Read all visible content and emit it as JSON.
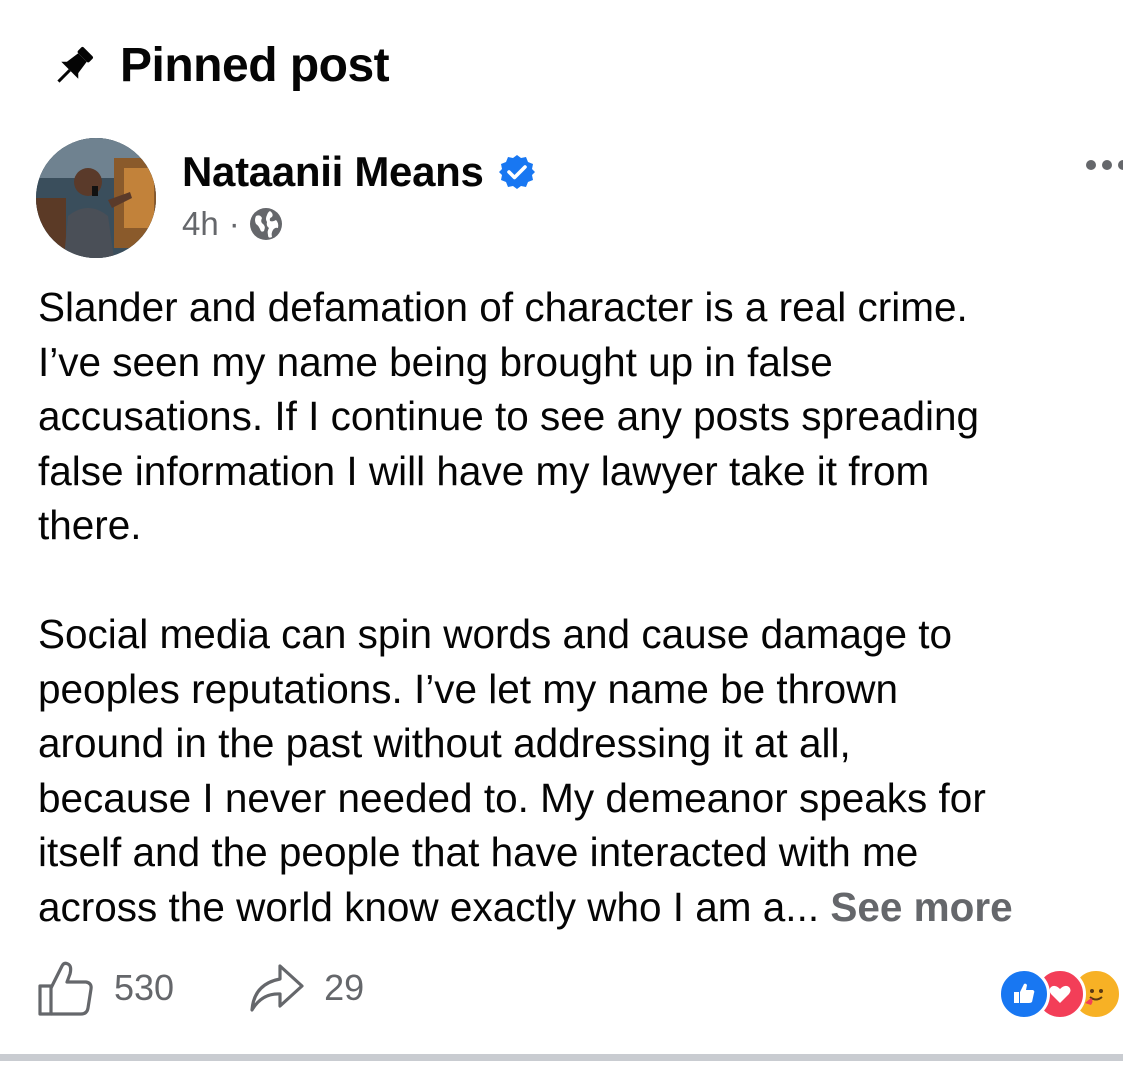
{
  "pinned": {
    "label": "Pinned post",
    "icon": "pin-icon"
  },
  "post": {
    "author": {
      "name": "Nataanii Means",
      "verified": true,
      "verified_icon": "verified-badge-icon",
      "avatar": "profile-photo"
    },
    "timestamp": "4h",
    "separator": "·",
    "audience_icon": "globe-icon",
    "more_icon": "more-options-icon",
    "body": {
      "paragraph1": [
        "Slander and defamation of character is a real crime.",
        "I’ve seen my name being brought up in false",
        "accusations. If I continue to see any posts spreading",
        "false information I will have my lawyer take it from",
        "there."
      ],
      "paragraph2": [
        "Social media can spin words and cause damage to",
        "peoples reputations. I’ve let my name be thrown",
        "around in the past without addressing it at all,",
        "because I never needed to. My demeanor speaks for",
        "itself and the people that have interacted with me",
        "across the world know exactly who I am a..."
      ],
      "see_more": " See more"
    },
    "stats": {
      "likes": "530",
      "shares": "29",
      "like_icon": "thumbs-up-icon",
      "share_icon": "share-arrow-icon",
      "reactions": [
        "like",
        "love",
        "care"
      ]
    }
  },
  "colors": {
    "text_primary": "#050505",
    "text_secondary": "#65676b",
    "verified_blue": "#1877f2",
    "like_blue": "#1877f2",
    "love_red": "#f33e58",
    "care_yellow": "#f7b125",
    "divider": "#c9ccd1"
  }
}
